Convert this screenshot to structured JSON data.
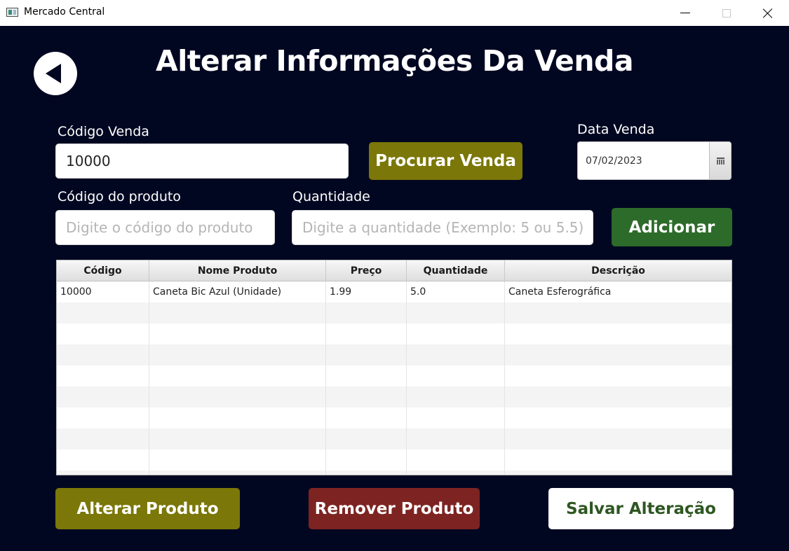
{
  "window": {
    "title": "Mercado Central",
    "icon": "app-window-icon",
    "controls": [
      "minimize-icon",
      "maximize-icon",
      "close-icon"
    ]
  },
  "page": {
    "title": "Alterar Informações Da Venda",
    "back_icon": "back-arrow-icon",
    "background_color": "#020721"
  },
  "form": {
    "codigo_venda": {
      "label": "Código Venda",
      "value": "10000"
    },
    "procurar_button": "Procurar Venda",
    "data_venda": {
      "label": "Data Venda",
      "value": "07/02/2023",
      "icon": "calendar-icon"
    },
    "codigo_produto": {
      "label": "Código do produto",
      "value": "",
      "placeholder": "Digite o código do produto"
    },
    "quantidade": {
      "label": "Quantidade",
      "value": "",
      "placeholder": "Digite a quantidade (Exemplo: 5 ou 5.5)"
    },
    "adicionar_button": "Adicionar"
  },
  "table": {
    "columns": [
      "Código",
      "Nome Produto",
      "Preço",
      "Quantidade",
      "Descrição"
    ],
    "rows": [
      [
        "10000",
        "Caneta Bic Azul (Unidade)",
        "1.99",
        "5.0",
        "Caneta Esferográfica"
      ]
    ]
  },
  "actions": {
    "alterar": "Alterar Produto",
    "remover": "Remover Produto",
    "salvar": "Salvar Alteração"
  },
  "colors": {
    "olive": "#7b7708",
    "green": "#2c6b29",
    "red": "#7d2422",
    "save_text": "#2e5722"
  }
}
